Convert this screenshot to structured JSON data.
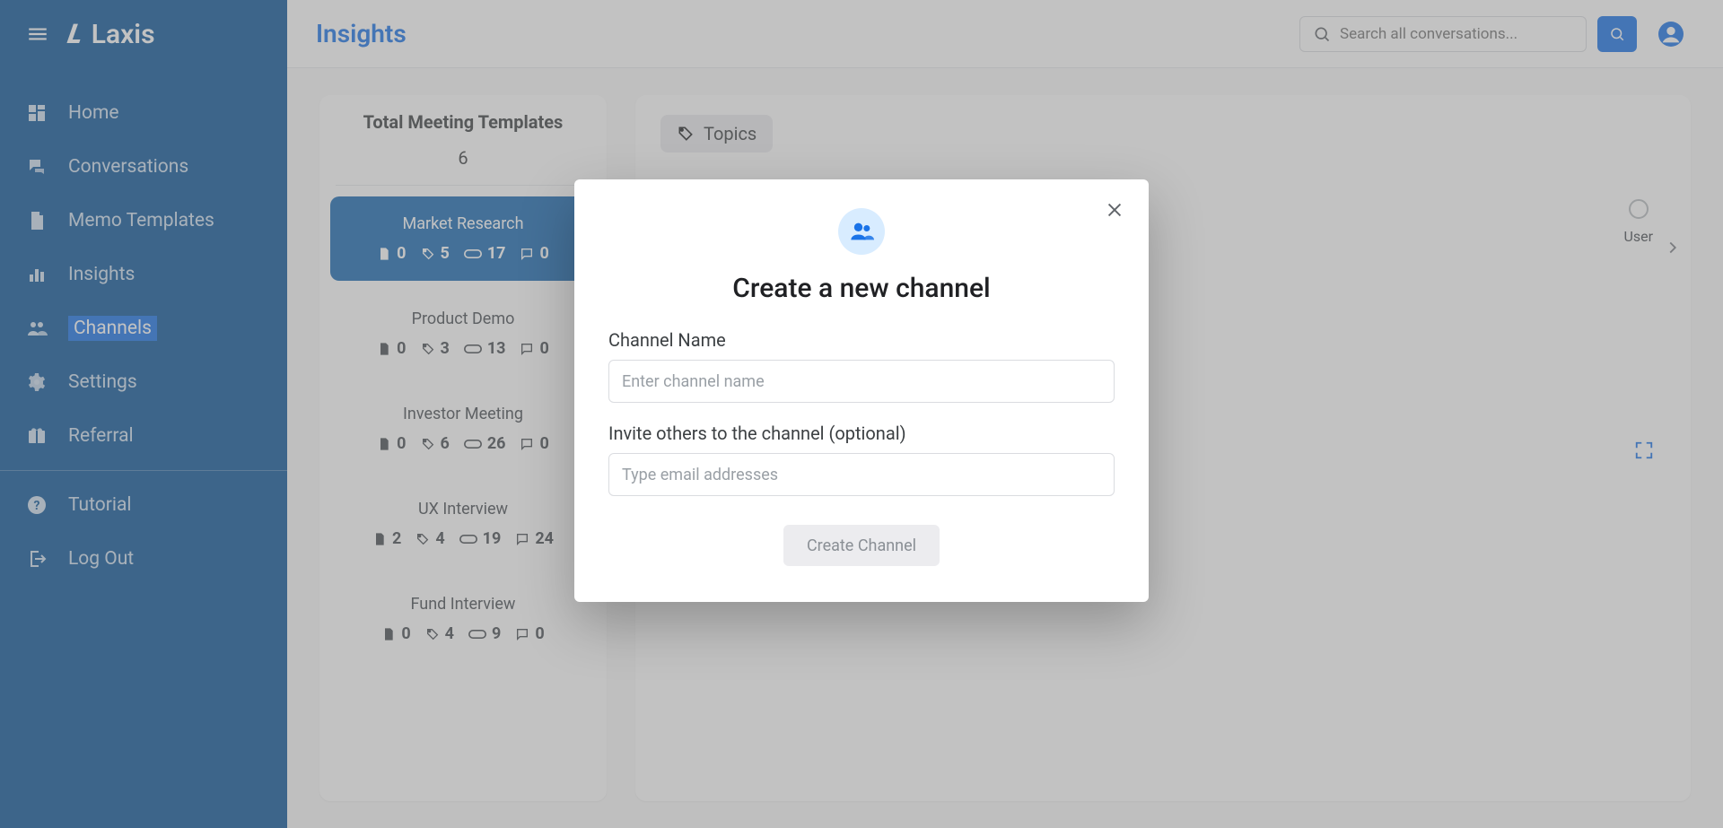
{
  "brand": {
    "mark": "L",
    "name": "Laxis"
  },
  "header": {
    "title": "Insights",
    "search_placeholder": "Search all conversations..."
  },
  "sidebar": {
    "primary": [
      {
        "key": "home",
        "label": "Home"
      },
      {
        "key": "conversations",
        "label": "Conversations"
      },
      {
        "key": "memo-templates",
        "label": "Memo Templates"
      },
      {
        "key": "insights",
        "label": "Insights"
      },
      {
        "key": "channels",
        "label": "Channels",
        "active": true
      },
      {
        "key": "settings",
        "label": "Settings"
      },
      {
        "key": "referral",
        "label": "Referral"
      }
    ],
    "secondary": [
      {
        "key": "tutorial",
        "label": "Tutorial"
      },
      {
        "key": "logout",
        "label": "Log Out"
      }
    ]
  },
  "templates": {
    "title": "Total Meeting Templates",
    "total": "6",
    "items": [
      {
        "name": "Market Research",
        "a": "0",
        "b": "5",
        "c": "17",
        "d": "0",
        "selected": true
      },
      {
        "name": "Product Demo",
        "a": "0",
        "b": "3",
        "c": "13",
        "d": "0"
      },
      {
        "name": "Investor Meeting",
        "a": "0",
        "b": "6",
        "c": "26",
        "d": "0"
      },
      {
        "name": "UX Interview",
        "a": "2",
        "b": "4",
        "c": "19",
        "d": "24"
      },
      {
        "name": "Fund Interview",
        "a": "0",
        "b": "4",
        "c": "9",
        "d": "0"
      }
    ]
  },
  "right": {
    "chip_label": "Topics",
    "user_label": "User"
  },
  "modal": {
    "title": "Create a new channel",
    "name_label": "Channel Name",
    "name_placeholder": "Enter channel name",
    "invite_label": "Invite others to the channel (optional)",
    "invite_placeholder": "Type email addresses",
    "submit_label": "Create Channel"
  }
}
